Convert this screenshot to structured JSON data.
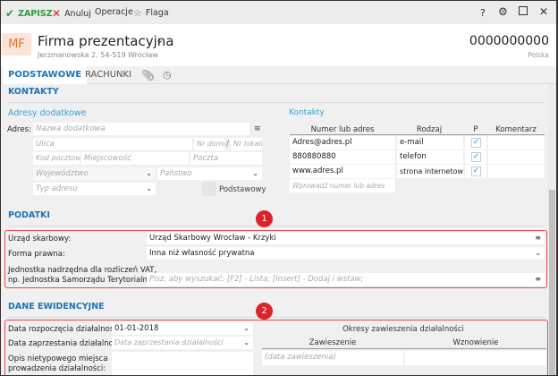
{
  "toolbar": {
    "save": "ZAPISZ",
    "cancel": "Anuluj",
    "operations": "Operacje",
    "flag": "Flaga",
    "help": "?"
  },
  "header": {
    "initials": "MF",
    "title": "Firma prezentacyjna",
    "address": "Jerzmanowska 2, 54-519 Wrocław",
    "number": "0000000000",
    "country": "Polska"
  },
  "tabs": [
    {
      "label": "PODSTAWOWE"
    },
    {
      "label": "RACHUNKI"
    }
  ],
  "kontakty": {
    "title": "KONTAKTY",
    "addresses": {
      "title": "Adresy dodatkowe",
      "label": "Adres:",
      "name_ph": "Nazwa dodatkowa",
      "street_ph": "Ulica",
      "house_ph": "Nr domu",
      "sep": "/",
      "flat_ph": "Nr lokalu",
      "zip_ph": "Kod pocztowy",
      "city_ph": "Miejscowość",
      "post_ph": "Poczta",
      "region_ph": "Województwo",
      "country_ph": "Państwo",
      "type_ph": "Typ adresu",
      "primary": "Podstawowy"
    },
    "contacts": {
      "title": "Kontakty",
      "columns": [
        "Numer lub adres",
        "Rodzaj",
        "P",
        "Komentarz"
      ],
      "rows": [
        {
          "value": "Adres@adres.pl",
          "type": "e-mail",
          "p": true,
          "comment": ""
        },
        {
          "value": "880880880",
          "type": "telefon",
          "p": true,
          "comment": ""
        },
        {
          "value": "www.adres.pl",
          "type": "strona internetowa",
          "p": true,
          "comment": ""
        }
      ],
      "new_ph": "Wprowadź numer lub adres"
    }
  },
  "podatki": {
    "title": "PODATKI",
    "badge": "1",
    "tax_office_label": "Urząd skarbowy:",
    "tax_office": "Urząd Skarbowy Wrocław - Krzyki",
    "legal_form_label": "Forma prawna:",
    "legal_form": "Inna niż własność prywatna",
    "vat_label_1": "Jednostka nadrzędna dla rozliczeń VAT,",
    "vat_label_2": "np. Jednostka Samorządu Terytorialnego:",
    "vat_ph": "Pisz, aby wyszukać; [F2] - Lista; [Insert] - Dodaj i wstaw;"
  },
  "dane": {
    "title": "DANE EWIDENCYJNE",
    "badge": "2",
    "start_label": "Data rozpoczęcia działalności:",
    "start": "01-01-2018",
    "end_label": "Data zaprzestania działalności:",
    "end_ph": "Data zaprzestania działalności",
    "desc_label_1": "Opis nietypowego miejsca",
    "desc_label_2": "prowadzenia działalności:",
    "periods_title": "Okresy zawieszenia działalności",
    "col_susp": "Zawieszenie",
    "col_resume": "Wznowienie",
    "susp_ph": "(data zawieszenia)"
  },
  "colors": {
    "accent": "#1f73b7",
    "save": "#2e9a3a",
    "cancel": "#d9242a",
    "badge": "#d9242a"
  }
}
